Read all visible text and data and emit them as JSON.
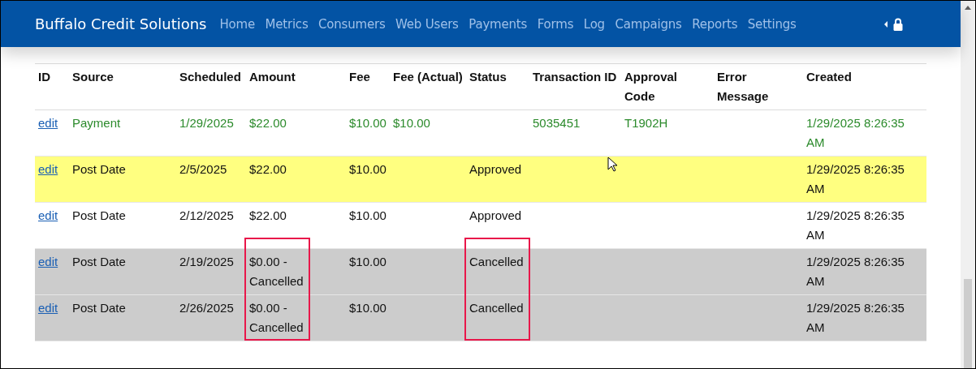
{
  "navbar": {
    "brand": "Buffalo Credit Solutions",
    "links": [
      "Home",
      "Metrics",
      "Consumers",
      "Web Users",
      "Payments",
      "Forms",
      "Log",
      "Campaigns",
      "Reports",
      "Settings"
    ]
  },
  "table": {
    "columns": [
      "ID",
      "Source",
      "Scheduled",
      "Amount",
      "Fee",
      "Fee (Actual)",
      "Status",
      "Transaction ID",
      "Approval Code",
      "Error Message",
      "Created"
    ],
    "rows": [
      {
        "kind": "completed",
        "cells": [
          {
            "text": "edit",
            "outlined": false
          },
          {
            "text": "Payment",
            "outlined": false
          },
          {
            "text": "1/29/2025",
            "outlined": false
          },
          {
            "text": "$22.00",
            "outlined": false
          },
          {
            "text": "$10.00",
            "outlined": false
          },
          {
            "text": "$10.00",
            "outlined": false
          },
          {
            "outlined": false
          },
          {
            "text": "5035451",
            "outlined": false
          },
          {
            "text": "T1902H",
            "outlined": false
          },
          {
            "outlined": false
          },
          {
            "text": "1/29/2025 8:26:35 AM",
            "outlined": false
          }
        ]
      },
      {
        "kind": "next",
        "cells": [
          {
            "text": "edit",
            "outlined": false
          },
          {
            "text": "Post Date",
            "outlined": false
          },
          {
            "text": "2/5/2025",
            "outlined": false
          },
          {
            "text": "$22.00",
            "outlined": false
          },
          {
            "text": "$10.00",
            "outlined": false
          },
          {
            "outlined": false
          },
          {
            "text": "Approved",
            "outlined": false
          },
          {
            "outlined": false
          },
          {
            "outlined": false
          },
          {
            "outlined": false
          },
          {
            "text": "1/29/2025 8:26:35 AM",
            "outlined": false
          }
        ]
      },
      {
        "kind": "normal",
        "cells": [
          {
            "text": "edit",
            "outlined": false
          },
          {
            "text": "Post Date",
            "outlined": false
          },
          {
            "text": "2/12/2025",
            "outlined": false
          },
          {
            "text": "$22.00",
            "outlined": false
          },
          {
            "text": "$10.00",
            "outlined": false
          },
          {
            "outlined": false
          },
          {
            "text": "Approved",
            "outlined": false
          },
          {
            "outlined": false
          },
          {
            "outlined": false
          },
          {
            "outlined": false
          },
          {
            "text": "1/29/2025 8:26:35 AM",
            "outlined": false
          }
        ]
      },
      {
        "kind": "cancelled",
        "cells": [
          {
            "text": "edit",
            "outlined": false
          },
          {
            "text": "Post Date",
            "outlined": false
          },
          {
            "text": "2/19/2025",
            "outlined": false
          },
          {
            "text": "$0.00 - Cancelled",
            "outlined": true
          },
          {
            "text": "$10.00",
            "outlined": false
          },
          {
            "outlined": false
          },
          {
            "text": "Cancelled",
            "outlined": true
          },
          {
            "outlined": false
          },
          {
            "outlined": false
          },
          {
            "outlined": false
          },
          {
            "text": "1/29/2025 8:26:35 AM",
            "outlined": false
          }
        ]
      },
      {
        "kind": "cancelled",
        "cells": [
          {
            "text": "edit",
            "outlined": false
          },
          {
            "text": "Post Date",
            "outlined": false
          },
          {
            "text": "2/26/2025",
            "outlined": false
          },
          {
            "text": "$0.00 - Cancelled",
            "outlined": true
          },
          {
            "text": "$10.00",
            "outlined": false
          },
          {
            "outlined": false
          },
          {
            "text": "Cancelled",
            "outlined": true
          },
          {
            "outlined": false
          },
          {
            "outlined": false
          },
          {
            "outlined": false
          },
          {
            "text": "1/29/2025 8:26:35 AM",
            "outlined": false
          }
        ]
      }
    ]
  }
}
